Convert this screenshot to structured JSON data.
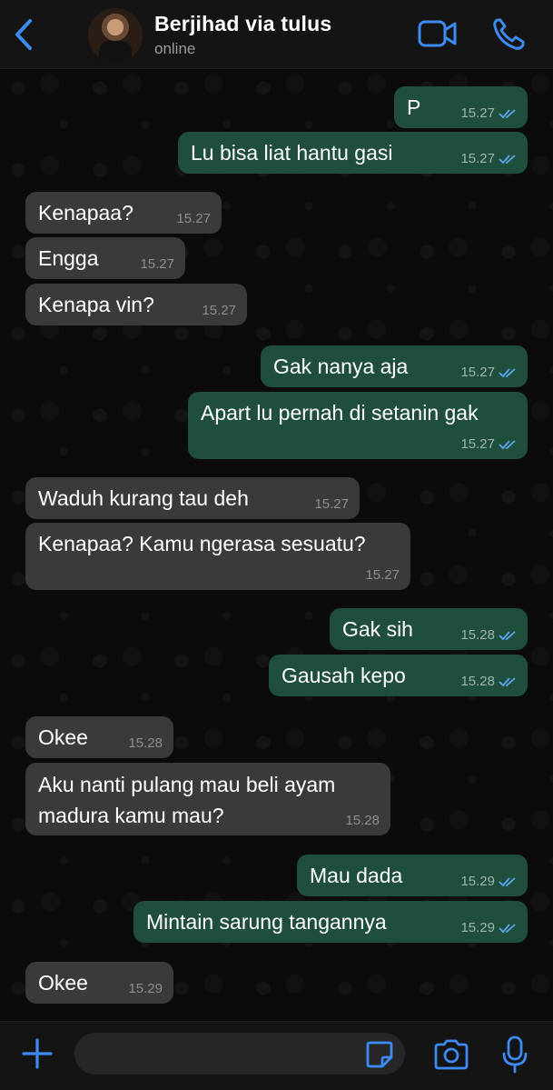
{
  "header": {
    "contact_name": "Berjihad via tulus",
    "status": "online",
    "back_icon": "chevron-left-icon",
    "video_icon": "video-camera-icon",
    "call_icon": "phone-icon"
  },
  "colors": {
    "accent": "#3d8bf2",
    "outgoing_bubble": "#1f4e3d",
    "incoming_bubble": "#3a3a3c",
    "read_tick": "#5aa6f0"
  },
  "messages": [
    {
      "dir": "out",
      "text": "P",
      "time": "15.27",
      "read": true
    },
    {
      "dir": "out",
      "text": "Lu bisa liat hantu gasi",
      "time": "15.27",
      "read": true
    },
    {
      "dir": "in",
      "text": "Kenapaa?",
      "time": "15.27"
    },
    {
      "dir": "in",
      "text": "Engga",
      "time": "15.27"
    },
    {
      "dir": "in",
      "text": "Kenapa vin?",
      "time": "15.27"
    },
    {
      "dir": "out",
      "text": "Gak nanya aja",
      "time": "15.27",
      "read": true
    },
    {
      "dir": "out",
      "text": "Apart lu pernah di setanin gak",
      "time": "15.27",
      "read": true
    },
    {
      "dir": "in",
      "text": "Waduh kurang tau deh",
      "time": "15.27"
    },
    {
      "dir": "in",
      "text": "Kenapaa? Kamu ngerasa sesuatu?",
      "time": "15.27"
    },
    {
      "dir": "out",
      "text": "Gak sih",
      "time": "15.28",
      "read": true
    },
    {
      "dir": "out",
      "text": "Gausah kepo",
      "time": "15.28",
      "read": true
    },
    {
      "dir": "in",
      "text": "Okee",
      "time": "15.28"
    },
    {
      "dir": "in",
      "text": "Aku nanti pulang mau beli ayam\nmadura kamu mau?",
      "time": "15.28"
    },
    {
      "dir": "out",
      "text": "Mau dada",
      "time": "15.29",
      "read": true
    },
    {
      "dir": "out",
      "text": "Mintain sarung tangannya",
      "time": "15.29",
      "read": true
    },
    {
      "dir": "in",
      "text": "Okee",
      "time": "15.29"
    }
  ],
  "composer": {
    "plus_icon": "plus-icon",
    "sticker_icon": "sticker-icon",
    "camera_icon": "camera-icon",
    "mic_icon": "microphone-icon",
    "input_value": "",
    "input_placeholder": ""
  }
}
